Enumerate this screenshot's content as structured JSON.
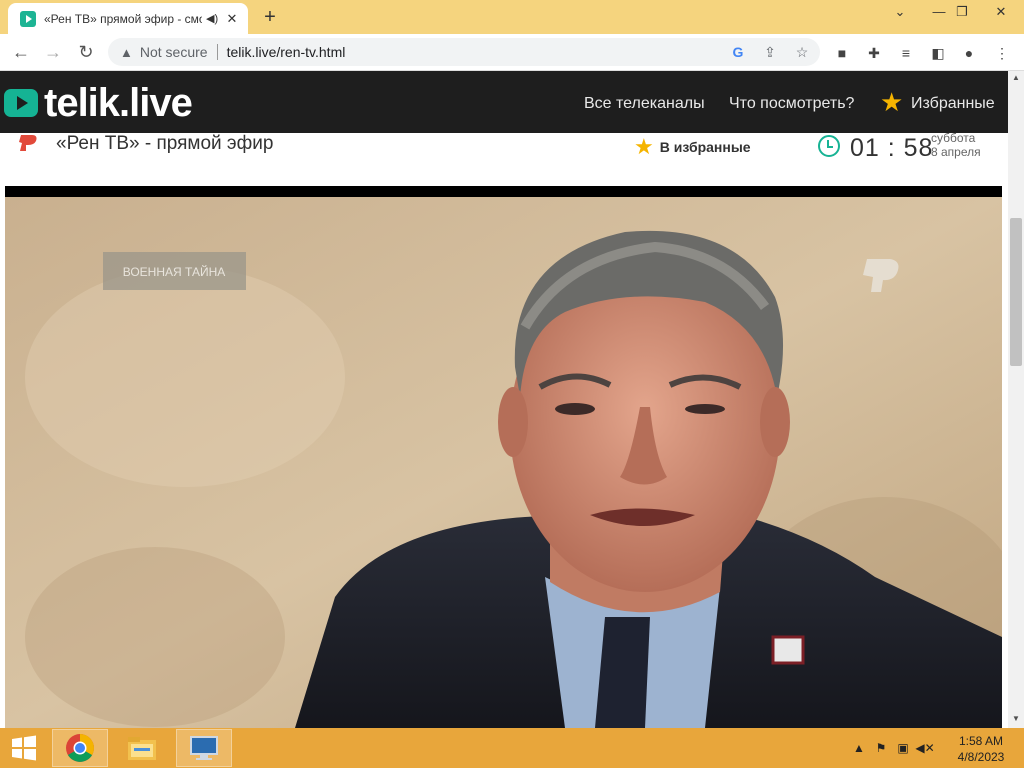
{
  "browser": {
    "tab_title": "«Рен ТВ» прямой эфир - смотреть онлайн",
    "new_tab_symbol": "+",
    "security_label": "Not secure",
    "url": "telik.live/ren-tv.html"
  },
  "site": {
    "logo": "telik.live",
    "nav": {
      "all_channels": "Все телеканалы",
      "what_to_watch": "Что посмотреть?",
      "favorites": "Избранные"
    }
  },
  "channel": {
    "title": "«Рен ТВ» - прямой эфир",
    "add_to_favorites": "В избранные",
    "time": "01 : 58",
    "day_name": "суббота",
    "date": "8 апреля"
  },
  "video": {
    "overlay_caption": "ВОЕННАЯ ТАЙНА"
  },
  "taskbar": {
    "time": "1:58 AM",
    "date": "4/8/2023"
  },
  "colors": {
    "accent": "#15b394",
    "star": "#f5b400",
    "header_bg": "#1e1e1e",
    "tabstrip_bg": "#f5d47e",
    "taskbar_bg": "#e8a63b"
  }
}
